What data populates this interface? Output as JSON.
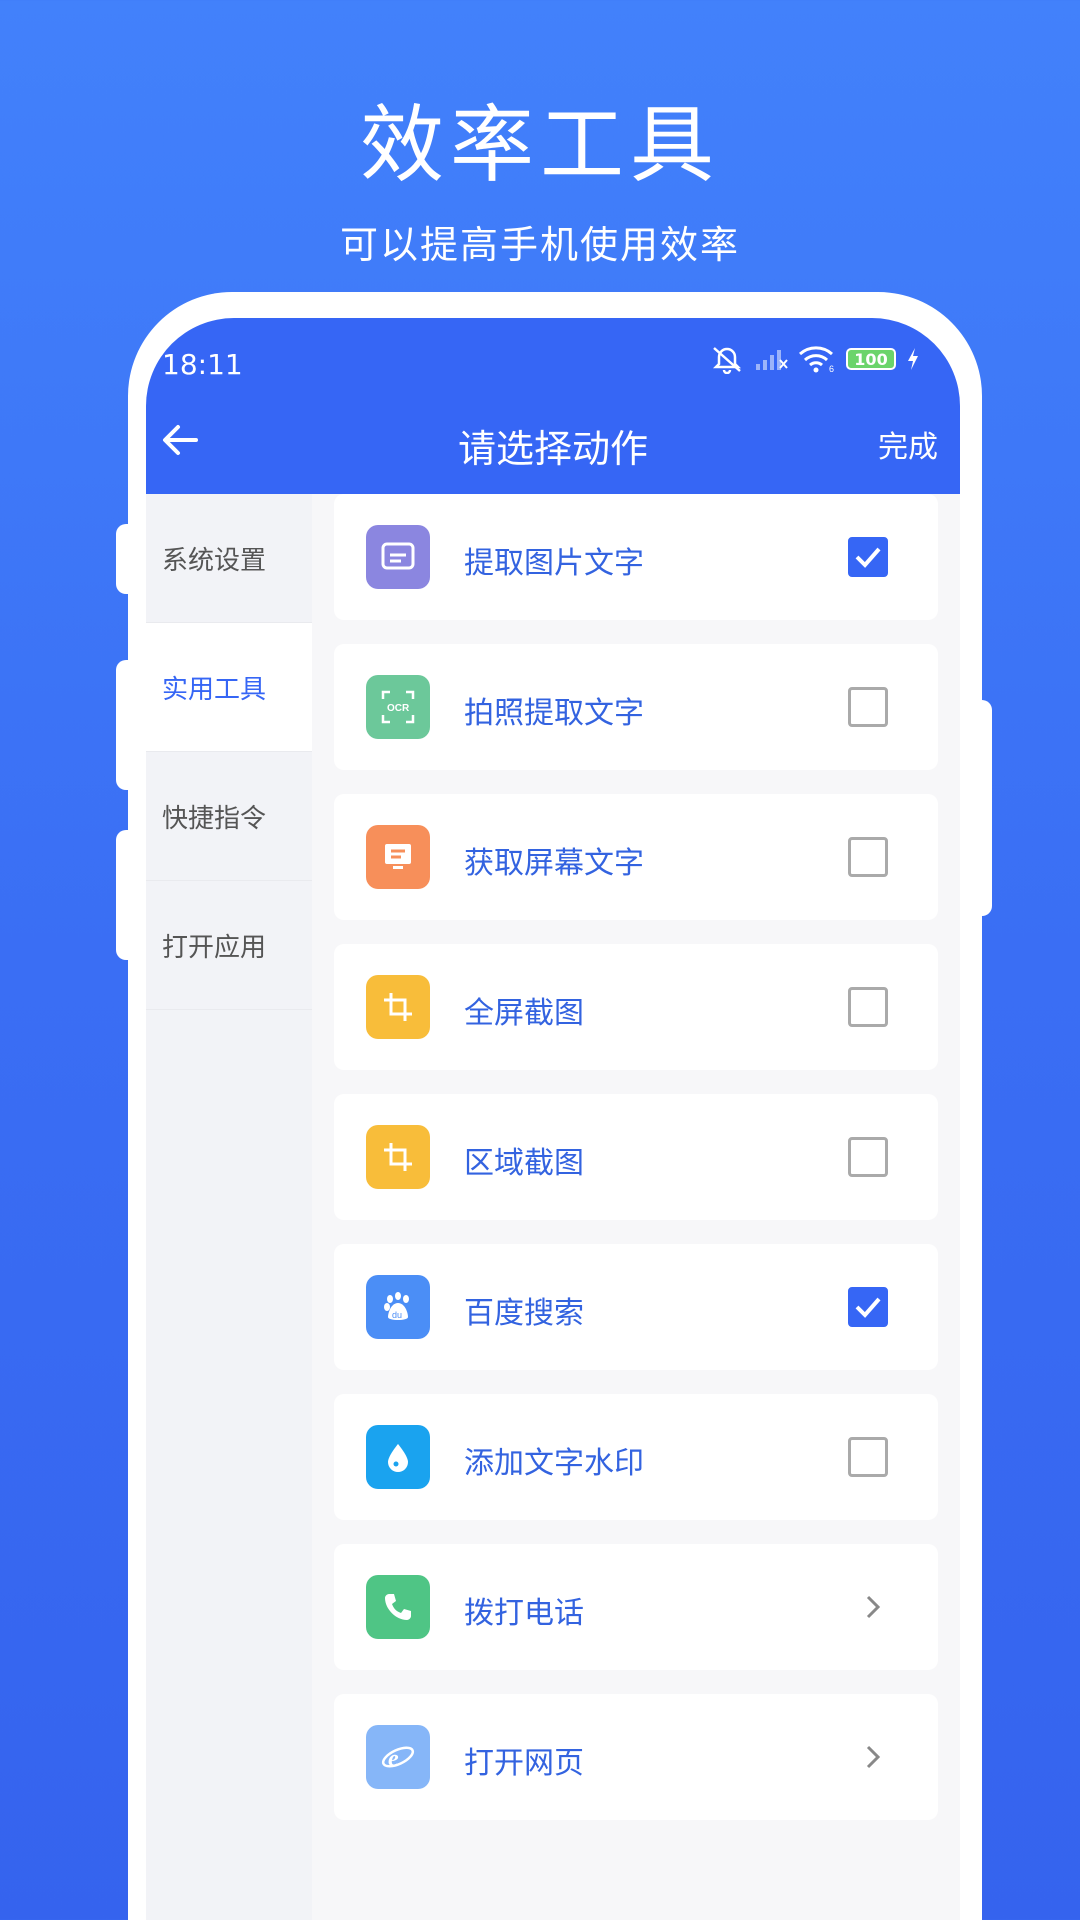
{
  "promo": {
    "title": "效率工具",
    "subtitle": "可以提高手机使用效率"
  },
  "status_bar": {
    "time": "18:11",
    "battery": "100"
  },
  "header": {
    "title": "请选择动作",
    "done_label": "完成"
  },
  "sidebar": {
    "items": [
      {
        "label": "系统设置",
        "active": false
      },
      {
        "label": "实用工具",
        "active": true
      },
      {
        "label": "快捷指令",
        "active": false
      },
      {
        "label": "打开应用",
        "active": false
      }
    ]
  },
  "actions": [
    {
      "label": "提取图片文字",
      "icon": "image-text-icon",
      "color": "#8b86e0",
      "control": "checkbox",
      "checked": true
    },
    {
      "label": "拍照提取文字",
      "icon": "ocr-icon",
      "color": "#6cc89a",
      "control": "checkbox",
      "checked": false
    },
    {
      "label": "获取屏幕文字",
      "icon": "screen-text-icon",
      "color": "#f78f5a",
      "control": "checkbox",
      "checked": false
    },
    {
      "label": "全屏截图",
      "icon": "crop-icon",
      "color": "#f8bd3a",
      "control": "checkbox",
      "checked": false
    },
    {
      "label": "区域截图",
      "icon": "crop-icon",
      "color": "#f8bd3a",
      "control": "checkbox",
      "checked": false
    },
    {
      "label": "百度搜索",
      "icon": "baidu-icon",
      "color": "#4b8ef6",
      "control": "checkbox",
      "checked": true
    },
    {
      "label": "添加文字水印",
      "icon": "water-drop-icon",
      "color": "#1aa3ef",
      "control": "checkbox",
      "checked": false
    },
    {
      "label": "拨打电话",
      "icon": "phone-icon",
      "color": "#4fc585",
      "control": "chevron"
    },
    {
      "label": "打开网页",
      "icon": "browser-icon",
      "color": "#86b6f8",
      "control": "chevron"
    }
  ],
  "colors": {
    "accent": "#3666f5",
    "label": "#3363e0"
  }
}
